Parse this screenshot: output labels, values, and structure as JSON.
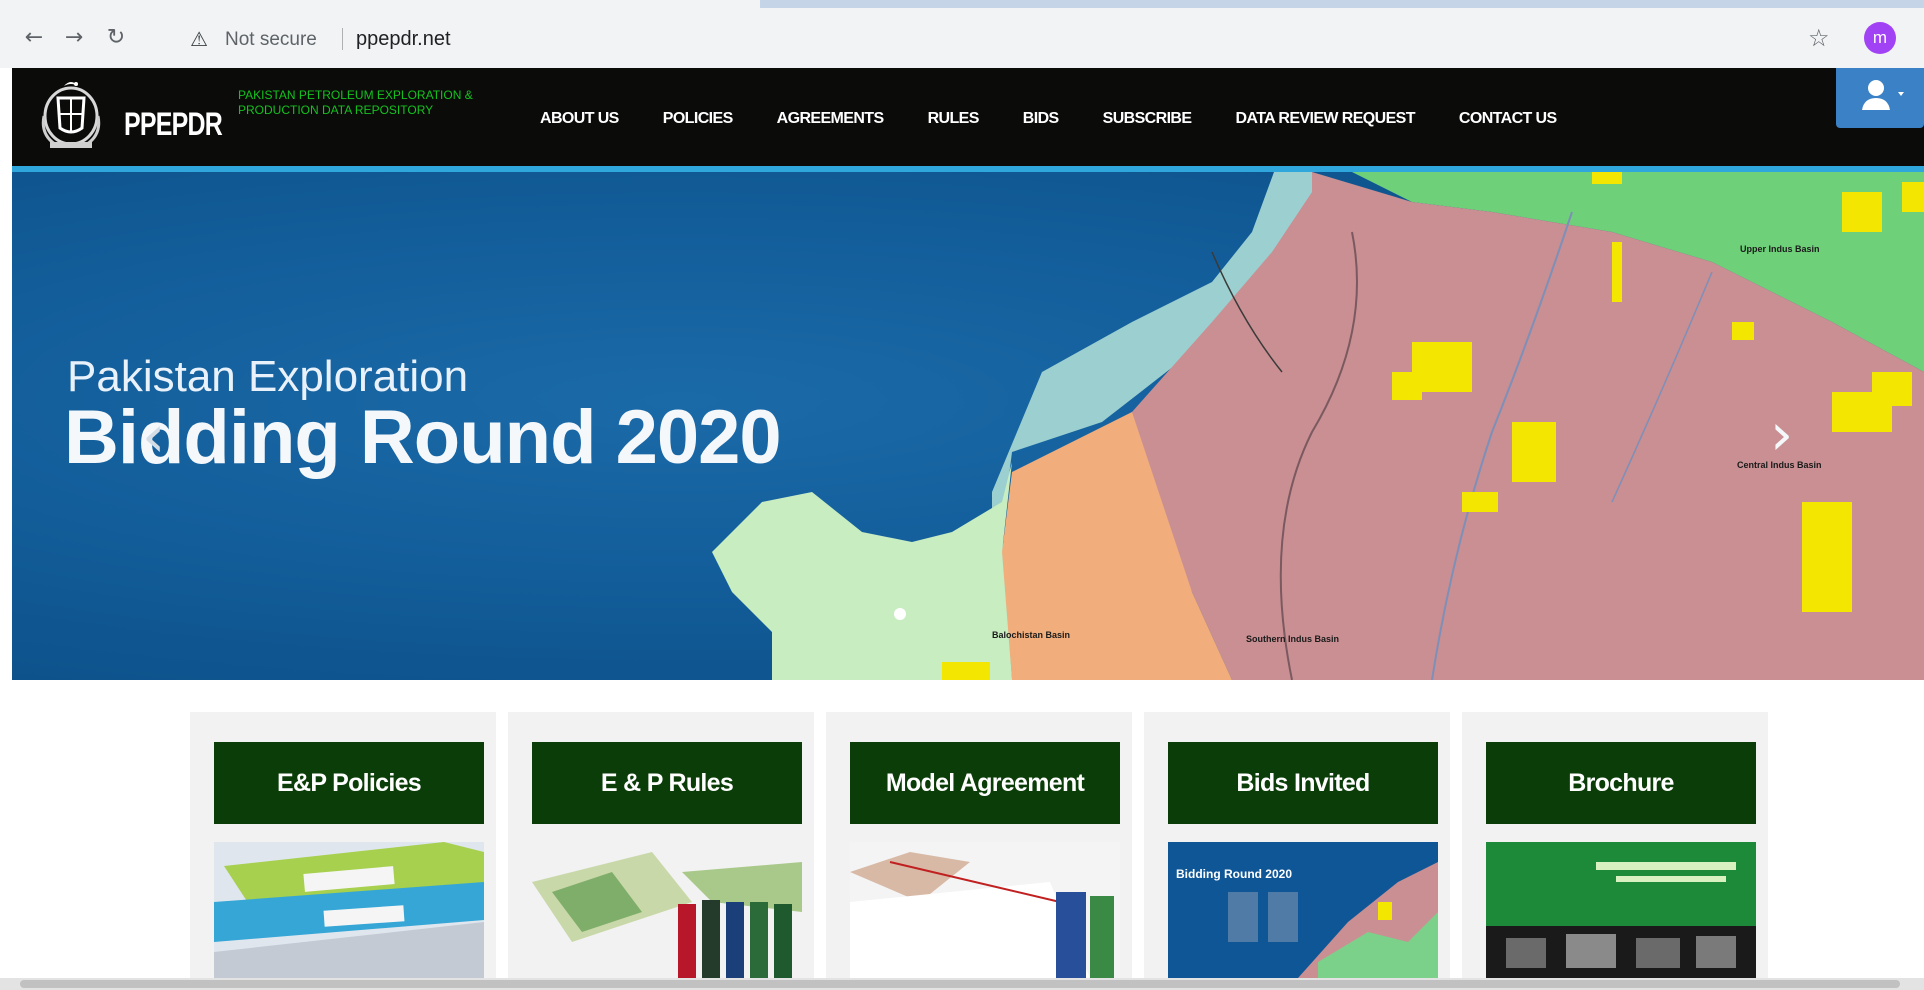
{
  "browser": {
    "back_icon": "arrow-left-icon",
    "forward_icon": "arrow-right-icon",
    "reload_icon": "reload-icon",
    "security_label": "Not secure",
    "url": "ppepdr.net",
    "profile_initial": "m"
  },
  "header": {
    "brand": "PPEPDR",
    "brand_subtitle": "PAKISTAN PETROLEUM EXPLORATION & PRODUCTION DATA REPOSITORY",
    "menu": [
      {
        "label": "ABOUT US"
      },
      {
        "label": "POLICIES"
      },
      {
        "label": "AGREEMENTS"
      },
      {
        "label": "RULES"
      },
      {
        "label": "BIDS"
      },
      {
        "label": "SUBSCRIBE"
      },
      {
        "label": "DATA REVIEW REQUEST"
      },
      {
        "label": "CONTACT US"
      }
    ],
    "user_icon": "user-icon"
  },
  "hero": {
    "subtitle": "Pakistan Exploration",
    "title": "Bidding Round 2020",
    "prev_arrow": "‹",
    "next_arrow": "›",
    "map_labels": {
      "upper_indus": "Upper Indus Basin",
      "central_indus": "Central Indus Basin",
      "southern_indus": "Southern Indus Basin",
      "balochistan": "Balochistan Basin"
    }
  },
  "cards": [
    {
      "title": "E&P Policies",
      "image": "folders-procedure-policies"
    },
    {
      "title": "E & P Rules",
      "image": "maps-and-binders"
    },
    {
      "title": "Model Agreement",
      "image": "signing-document"
    },
    {
      "title": "Bids Invited",
      "image": "bidding-round-brochure",
      "image_text": "Bidding Round 2020"
    },
    {
      "title": "Brochure",
      "image": "brochure-conference"
    }
  ],
  "colors": {
    "header_bg": "#0b0c0a",
    "brand_green": "#14c11e",
    "hero_blue": "#125d9a",
    "card_title_bg": "#0b3d08",
    "accent_blue": "#2fa6dc"
  }
}
